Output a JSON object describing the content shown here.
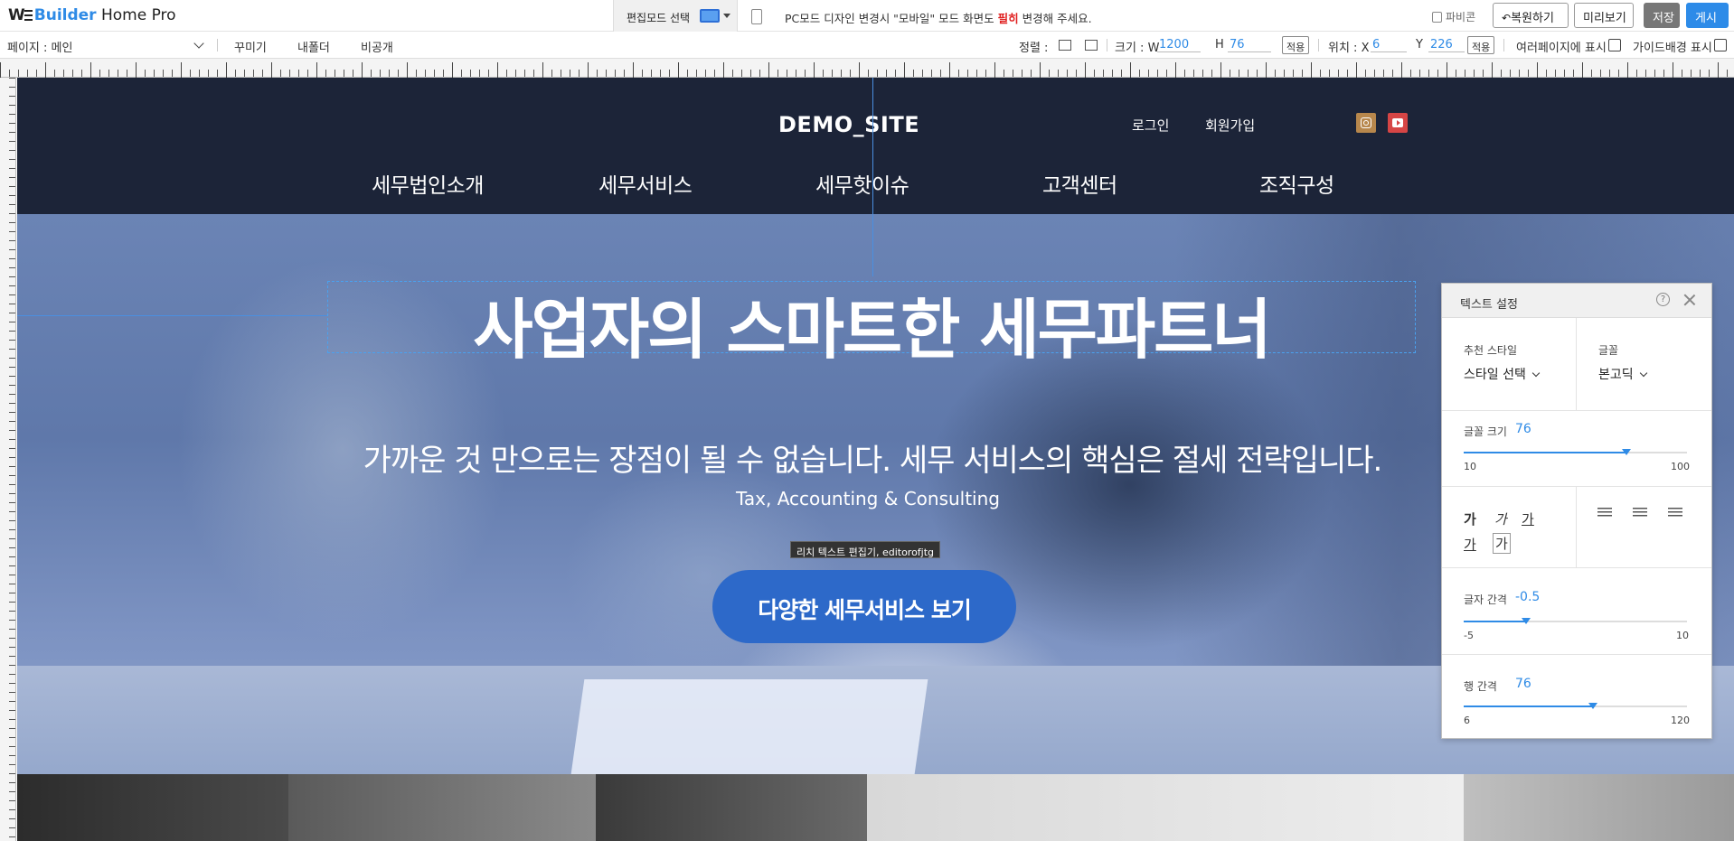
{
  "app": {
    "logo_we": "W",
    "logo_builder": "Builder",
    "logo_rest": " Home Pro"
  },
  "topbar": {
    "edit_mode_label": "편집모드 선택",
    "notice_prefix": "PC모드 디자인 변경시 \"모바일\" 모드 화면도 ",
    "notice_highlight": "필히",
    "notice_suffix": " 변경해 주세요.",
    "favicon_label": "파비콘",
    "restore_label": "복원하기",
    "preview_label": "미리보기",
    "save_label": "저장",
    "publish_label": "게시"
  },
  "toolbar": {
    "page_label": "페이지 : 메인",
    "decorate_label": "꾸미기",
    "folder_label": "내폴더",
    "private_label": "비공개",
    "align_label": "정렬 :",
    "size_label": "크기 : W",
    "width_value": "1200",
    "h_label": "H",
    "height_value": "76",
    "apply_label": "적용",
    "position_label": "위치 : X",
    "x_value": "6",
    "y_label": "Y",
    "y_value": "226",
    "apply2_label": "적용",
    "multi_page_label": "여러페이지에 표시",
    "guide_bg_label": "가이드배경 표시"
  },
  "site": {
    "name": "DEMO_SITE",
    "login": "로그인",
    "signup": "회원가입",
    "nav": [
      "세무법인소개",
      "세무서비스",
      "세무핫이슈",
      "고객센터",
      "조직구성"
    ],
    "hero_title": "사업자의 스마트한 세무파트너",
    "hero_subtitle": "가까운 것 만으로는 장점이 될 수 없습니다. 세무 서비스의 핵심은 절세 전략입니다.",
    "hero_english": "Tax, Accounting & Consulting",
    "editor_tooltip": "리치 텍스트 편집기, editorofjtg",
    "cta_label": "다양한 세무서비스 보기"
  },
  "panel": {
    "title": "텍스트 설정",
    "help_symbol": "?",
    "recommended_style_label": "추천 스타일",
    "recommended_style_value": "스타일 선택",
    "font_label": "글꼴",
    "font_value": "본고딕",
    "font_size_label": "글꼴 크기",
    "font_size_value": "76",
    "font_size_min": "10",
    "font_size_max": "100",
    "style_glyphs": [
      "가",
      "가",
      "가",
      "가",
      "가"
    ],
    "letter_spacing_label": "글자 간격",
    "letter_spacing_value": "-0.5",
    "letter_spacing_min": "-5",
    "letter_spacing_max": "10",
    "line_height_label": "행 간격",
    "line_height_value": "76",
    "line_height_min": "6",
    "line_height_max": "120"
  },
  "colors": {
    "accent": "#2f8be6",
    "header_bg": "#1c2438",
    "cta_bg": "#2d69c9",
    "notice_highlight": "#e02020"
  }
}
